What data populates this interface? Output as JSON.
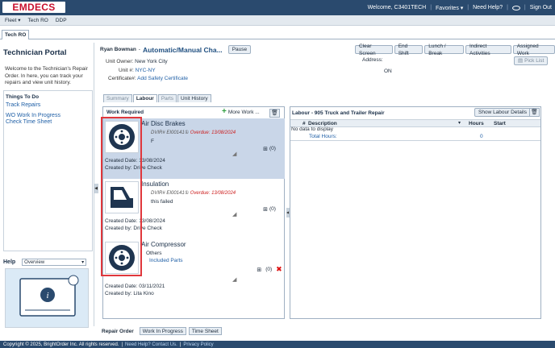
{
  "app": {
    "logo": "EMDECS"
  },
  "topbar": {
    "welcome": "Welcome, C3401TECH",
    "favorites": "Favorites",
    "need_help": "Need Help?",
    "sign_out": "Sign Out"
  },
  "nav": {
    "items": [
      "Fleet",
      "Tech RO",
      "DDP"
    ]
  },
  "tabs": {
    "active": "Tech RO"
  },
  "left": {
    "title": "Technician Portal",
    "welcome": "Welcome to the Technician's Repair Order. In here, you can track your repairs and view unit history.",
    "todo_title": "Things To Do",
    "links": [
      "Track Repairs",
      "WO Work In Progress",
      "Check Time Sheet"
    ],
    "help_label": "Help",
    "help_select": "Overview"
  },
  "header": {
    "name": "Ryan Bowman",
    "mode": "Automatic/Manual Cha...",
    "pause": "Pause",
    "buttons": [
      "Clear Screen",
      "End Shift",
      "Lunch / Break",
      "Indirect Activities",
      "Assigned Work"
    ],
    "pick_list": "Pick List",
    "unit_owner_label": "Unit Owner:",
    "unit_owner": "New York City",
    "unit_label": "Unit #:",
    "unit": "NYC-NY",
    "cert_label": "Certificate#:",
    "cert": "Add Safety Certificate",
    "address_label": "Address:",
    "status": "ON"
  },
  "subtabs": [
    "Summary",
    "Labour",
    "Parts",
    "Unit History"
  ],
  "work": {
    "title": "Work Required",
    "more_work": "More Work ...",
    "cards": [
      {
        "title": "Air Disc Brakes",
        "dvir": "DVIR# EI00141①",
        "overdue": "Overdue: 13/08/2024",
        "cause": "F",
        "date_label": "Created Date:",
        "date": "13/08/2024",
        "by_label": "Created by:",
        "by": "Drive Check",
        "count": "(0)"
      },
      {
        "title": "Insulation",
        "dvir": "DVIR# EI00141①",
        "overdue": "Overdue: 13/08/2024",
        "cause": "this failed",
        "date_label": "Created Date:",
        "date": "13/08/2024",
        "by_label": "Created by:",
        "by": "Drive Check",
        "count": "(0)"
      },
      {
        "title": "Air Compressor",
        "sub": "Others",
        "link": "Included Parts",
        "date_label": "Created Date:",
        "date": "03/11/2021",
        "by_label": "Created by:",
        "by": "Lita Kino",
        "count": "(0)"
      }
    ]
  },
  "labour": {
    "title": "Labour - 905 Truck and Trailer Repair",
    "show_details": "Show Labour Details",
    "columns": [
      "#",
      "Description",
      "Hours",
      "Start"
    ],
    "empty": "No data to display",
    "total_label": "Total Hours:",
    "total": "0"
  },
  "bottom_tabs": [
    "Repair Order",
    "Work In Progress",
    "Time Sheet"
  ],
  "footer": {
    "copyright": "Copyright © 2025, BrightOrder Inc. All rights reserved.",
    "help": "Need Help? Contact Us.",
    "privacy": "Privacy Policy"
  },
  "colors": {
    "topbar": "#2a4a6e",
    "selected_card": "#c9d6e8",
    "highlight": "#e0373c",
    "overdue": "#cc1f1f"
  }
}
